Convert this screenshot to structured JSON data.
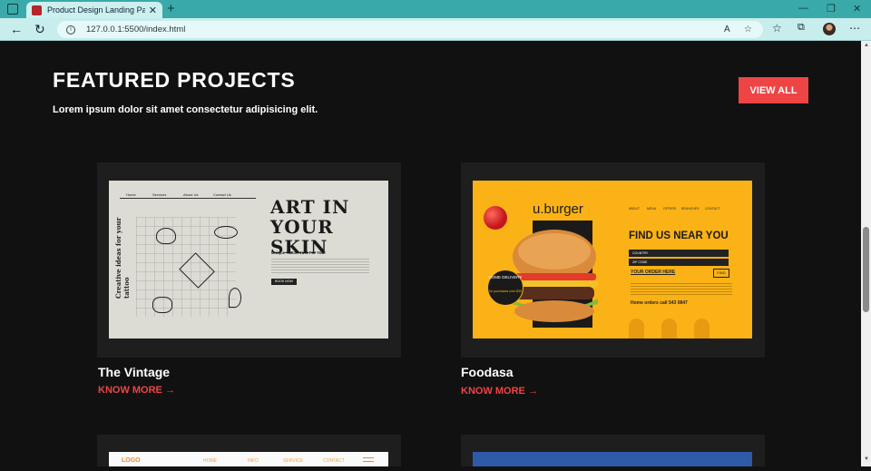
{
  "browser": {
    "tab_title": "Product Design Landing Page",
    "url": "127.0.0.1:5500/index.html"
  },
  "section": {
    "title": "FEATURED PROJECTS",
    "subtitle": "Lorem ipsum dolor sit amet consectetur adipisicing elit.",
    "view_all_label": "VIEW ALL"
  },
  "projects": [
    {
      "name": "The Vintage",
      "link_label": "KNOW MORE →",
      "thumb": {
        "nav": [
          "Home",
          "Services",
          "About Us",
          "Contact Us"
        ],
        "side_text": "Creative ideas for your tattoo",
        "headline_1": "ART IN",
        "headline_2": "YOUR SKIN",
        "tagline": "Unique Tattoo Just For You!",
        "button": "BOOK NOW"
      }
    },
    {
      "name": "Foodasa",
      "link_label": "KNOW MORE →",
      "thumb": {
        "logo": "u.burger",
        "nav": [
          "ABOUT",
          "MENU",
          "OFFERS",
          "BRANCHES",
          "CONTACT"
        ],
        "heading": "FIND US NEAR YOU",
        "country": "COUNTRY",
        "zip": "ZIP CODE",
        "order": "YOUR ORDER HERE",
        "find": "FIND",
        "phone": "Home orders call 543 0847",
        "badge_title": "HOME DELIVERY",
        "badge_sub": "for purchases over $30"
      }
    }
  ],
  "next_row": {
    "logo": "LOGO",
    "nav": [
      "HOME",
      "INFO",
      "SERVICE",
      "CONTACT"
    ]
  },
  "colors": {
    "accent": "#ef4444",
    "page_bg": "#111111",
    "card_bg": "#1e1e1e",
    "food_yellow": "#fbb216"
  }
}
